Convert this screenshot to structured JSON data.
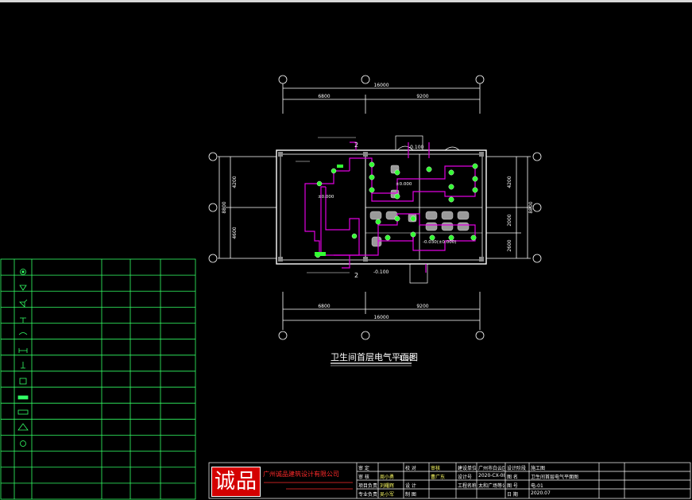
{
  "drawing": {
    "title": "卫生间首层电气平面图",
    "scale": "1:50"
  },
  "dimensions": {
    "top_total": "16000",
    "top_left": "6800",
    "top_right": "9200",
    "bottom_total": "16000",
    "bottom_left": "6800",
    "bottom_right": "9200",
    "left_upper": "4200",
    "left_total": "8800",
    "left_lower": "4600",
    "right_upper": "4200",
    "right_total": "8800",
    "right_mid": "2000",
    "right_lower": "2600"
  },
  "section_marks": {
    "top": "2",
    "bottom": "2"
  },
  "levels": {
    "top": "-0.100",
    "bottom": "-0.100",
    "room_left": "±0.000",
    "room_mid": "±0.000",
    "room_right": "-0.030(±0.000)"
  },
  "titleblock": {
    "company": "广州诚品建筑设计有限公司",
    "logo_text": "诚品",
    "row1": [
      "审 定",
      "",
      "校 对",
      "审核",
      "建设单位",
      "广州市白云区太和镇人民政府",
      "设计阶段",
      "施工图"
    ],
    "row2": [
      "审 核",
      "周小勇",
      "",
      "曹广东",
      "设计号",
      "2020-CX-08",
      "图 名",
      "卫生间首层电气平面图"
    ],
    "row3": [
      "项目负责",
      "刘耀辉",
      "设 计",
      "",
      "工程名称",
      "太和广场等公共卫生间改造工程",
      "图 号",
      "电-01"
    ],
    "row4": [
      "专业负责",
      "吴小军",
      "制 图",
      "",
      "",
      "",
      "日 期",
      "2020.07"
    ]
  },
  "legend_panel": {
    "rows": 15
  }
}
